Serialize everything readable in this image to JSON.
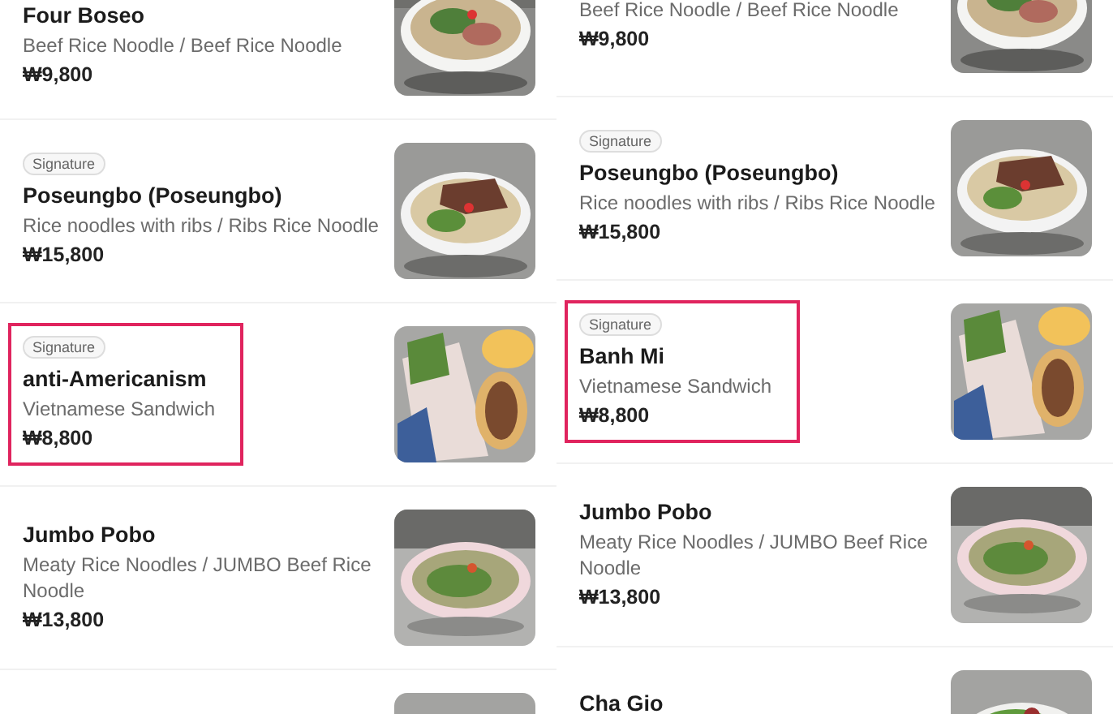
{
  "panels": [
    {
      "items": [
        {
          "name": "Four Boseo",
          "description": "Beef Rice Noodle / Beef Rice Noodle",
          "price": "₩9,800",
          "highlighted": false
        },
        {
          "badge": "Signature",
          "name": "Poseungbo (Poseungbo)",
          "description": "Rice noodles with ribs / Ribs Rice Noodle",
          "price": "₩15,800",
          "highlighted": false
        },
        {
          "badge": "Signature",
          "name": "anti-Americanism",
          "description": "Vietnamese Sandwich",
          "price": "₩8,800",
          "highlighted": true
        },
        {
          "name": "Jumbo Pobo",
          "description": "Meaty Rice Noodles / JUMBO Beef Rice Noodle",
          "price": "₩13,800",
          "highlighted": false
        },
        {
          "kind": "picture"
        }
      ]
    },
    {
      "items": [
        {
          "description": "Beef Rice Noodle / Beef Rice Noodle",
          "price": "₩9,800",
          "highlighted": false
        },
        {
          "badge": "Signature",
          "name": "Poseungbo (Poseungbo)",
          "description": "Rice noodles with ribs / Ribs Rice Noodle",
          "price": "₩15,800",
          "highlighted": false
        },
        {
          "badge": "Signature",
          "name": "Banh Mi",
          "description": "Vietnamese Sandwich",
          "price": "₩8,800",
          "highlighted": true
        },
        {
          "name": "Jumbo Pobo",
          "description": "Meaty Rice Noodles / JUMBO Beef Rice Noodle",
          "price": "₩13,800",
          "highlighted": false
        },
        {
          "name": "Cha Gio"
        }
      ]
    }
  ]
}
